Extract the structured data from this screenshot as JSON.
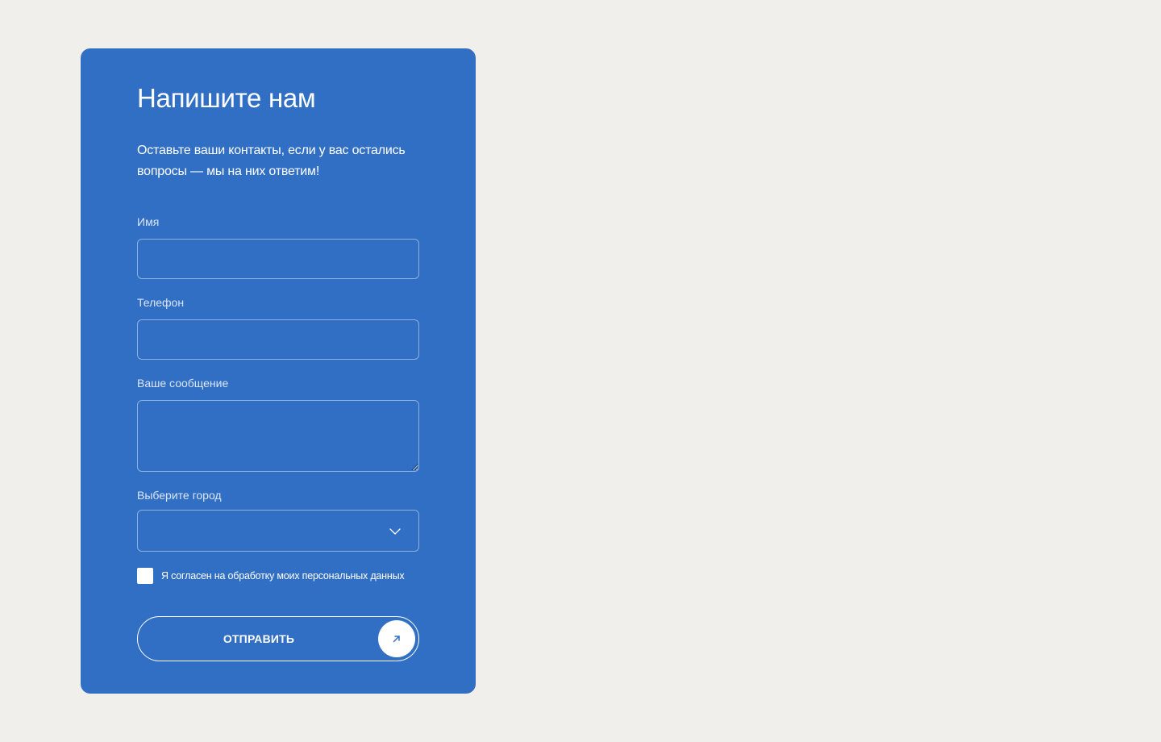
{
  "form": {
    "title": "Напишите нам",
    "subtitle": "Оставьте ваши контакты, если у вас остались вопросы — мы на них ответим!",
    "name_label": "Имя",
    "name_value": "",
    "phone_label": "Телефон",
    "phone_value": "",
    "message_label": "Ваше сообщение",
    "message_value": "",
    "city_label": "Выберите город",
    "city_value": "",
    "consent_checked": false,
    "consent_text": "Я согласен на обработку моих персональных данных",
    "submit_label": "ОТПРАВИТЬ"
  },
  "icons": {
    "select_toggle": "chevron-down-icon",
    "submit": "arrow-up-right-icon"
  },
  "colors": {
    "page_background": "#f0efeb",
    "card_background": "#316fc4",
    "text": "#ffffff",
    "accent": "#316fc4"
  }
}
